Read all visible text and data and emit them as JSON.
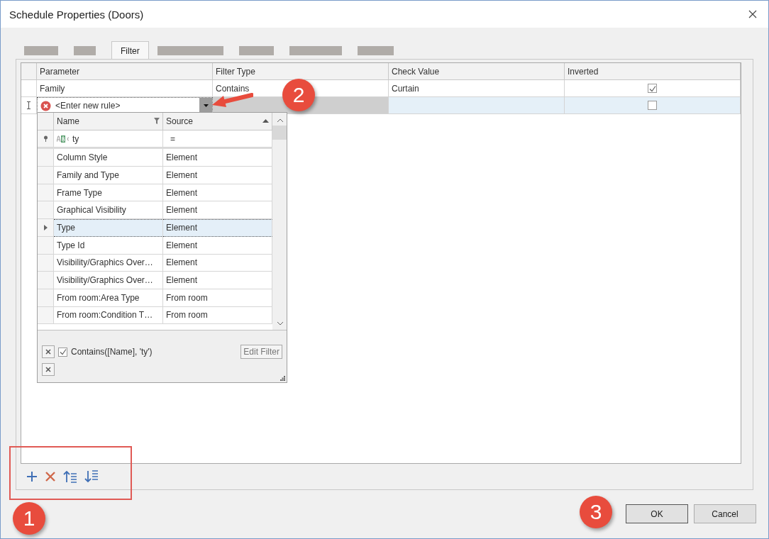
{
  "window": {
    "title": "Schedule Properties (Doors)"
  },
  "tabs": [
    {
      "kind": "hidden",
      "selected": false
    },
    {
      "kind": "hidden",
      "selected": false
    },
    {
      "kind": "text",
      "label": "Filter",
      "selected": true
    },
    {
      "kind": "hidden",
      "selected": false
    },
    {
      "kind": "hidden",
      "selected": false
    },
    {
      "kind": "hidden",
      "selected": false
    },
    {
      "kind": "hidden",
      "selected": false
    }
  ],
  "grid": {
    "columns": [
      "Parameter",
      "Filter Type",
      "Check Value",
      "Inverted"
    ],
    "rows": [
      {
        "kind": "rule",
        "parameter": "Family",
        "filter_type": "Contains",
        "check_value": "Curtain",
        "inverted": true
      },
      {
        "kind": "new",
        "parameter": "<Enter new rule>",
        "inverted": false
      }
    ]
  },
  "lookup": {
    "columns": [
      "Name",
      "Source"
    ],
    "filter_row": {
      "name": "ty",
      "source": "="
    },
    "rows": [
      {
        "name": "Column Style",
        "source": "Element",
        "selected": false
      },
      {
        "name": "Family and Type",
        "source": "Element",
        "selected": false
      },
      {
        "name": "Frame Type",
        "source": "Element",
        "selected": false
      },
      {
        "name": "Graphical Visibility",
        "source": "Element",
        "selected": false
      },
      {
        "name": "Type",
        "source": "Element",
        "selected": true
      },
      {
        "name": "Type Id",
        "source": "Element",
        "selected": false
      },
      {
        "name": "Visibility/Graphics Over…",
        "source": "Element",
        "selected": false
      },
      {
        "name": "Visibility/Graphics Over…",
        "source": "Element",
        "selected": false
      },
      {
        "name": "From room:Area Type",
        "source": "From room",
        "selected": false
      },
      {
        "name": "From room:Condition T…",
        "source": "From room",
        "selected": false
      }
    ],
    "filter_expression": {
      "text": "Contains([Name], 'ty')",
      "checked": true
    },
    "edit_filter": "Edit Filter"
  },
  "buttons": [
    "OK",
    "Cancel"
  ],
  "annotations": [
    "1",
    "2",
    "3"
  ]
}
